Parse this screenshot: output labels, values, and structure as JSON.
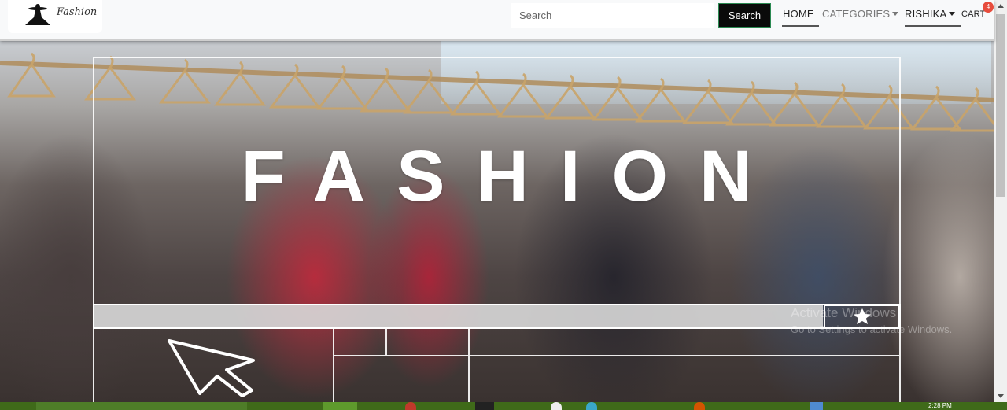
{
  "navbar": {
    "logo_text": "Fashion",
    "search_placeholder": "Search",
    "search_button": "Search",
    "links": {
      "home": "HOME",
      "categories": "CATEGORIES",
      "user": "RISHIKA",
      "cart": "CART"
    },
    "cart_count": "4"
  },
  "hero": {
    "title": "FASHION",
    "icons": [
      "star-icon",
      "cursor-arrow-icon"
    ]
  },
  "watermark": {
    "line1": "Activate Windows",
    "line2": "Go to Settings to activate Windows."
  },
  "taskbar": {
    "time": "2:28 PM"
  },
  "colors": {
    "navbar_bg": "#f8f9fa",
    "search_button_bg": "#0a0a0a",
    "cart_badge": "#e74c3c",
    "taskbar": "#3f6a19"
  }
}
